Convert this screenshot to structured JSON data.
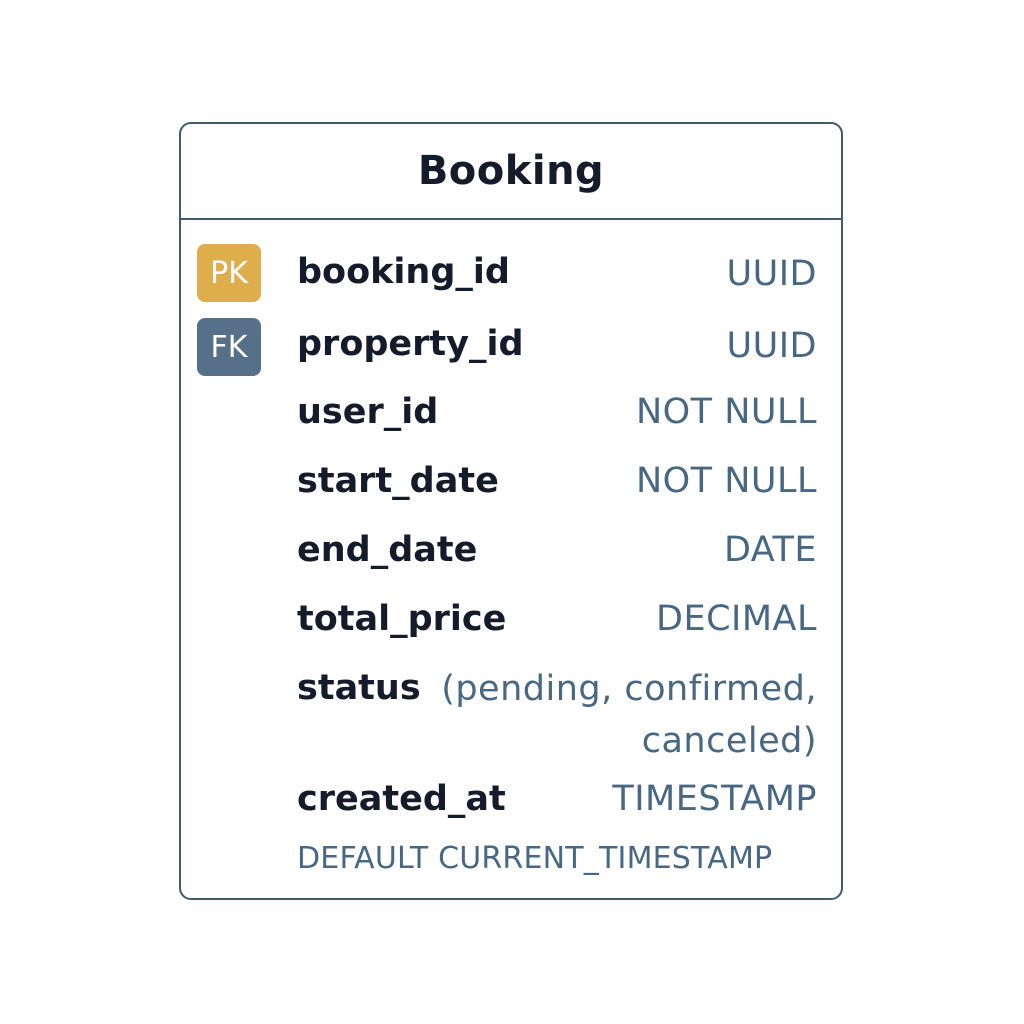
{
  "entity": {
    "title": "Booking",
    "fields": [
      {
        "key": "PK",
        "name": "booking_id",
        "type": "UUID"
      },
      {
        "key": "FK",
        "name": "property_id",
        "type": "UUID"
      },
      {
        "key": "",
        "name": "user_id",
        "type": "NOT NULL"
      },
      {
        "key": "",
        "name": "start_date",
        "type": "NOT NULL"
      },
      {
        "key": "",
        "name": "end_date",
        "type": "DATE"
      },
      {
        "key": "",
        "name": "total_price",
        "type": "DECIMAL"
      },
      {
        "key": "",
        "name": "status",
        "type": "(pending, confirmed, canceled)"
      },
      {
        "key": "",
        "name": "created_at",
        "type": "TIMESTAMP",
        "default": "DEFAULT CURRENT_TIMESTAMP"
      }
    ]
  },
  "colors": {
    "border": "#3e5a74",
    "pk_badge": "#dfae4c",
    "fk_badge": "#567089",
    "field_name": "#141b2b",
    "field_type": "#476782"
  }
}
